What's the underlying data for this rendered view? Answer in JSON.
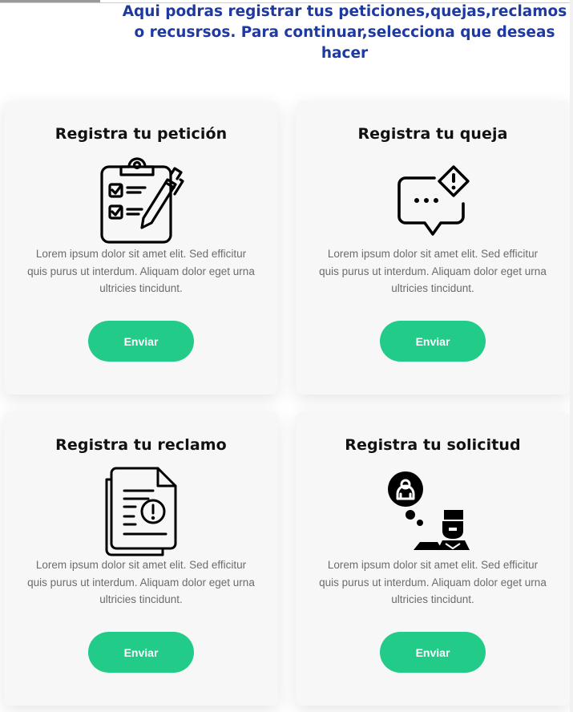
{
  "intro": {
    "text": "Aqui podras registrar tus peticiones,quejas,reclamos o recusrsos. Para continuar,selecciona que deseas hacer"
  },
  "cards": [
    {
      "title": "Registra tu petición",
      "icon": "clipboard-checklist-pen-icon",
      "description": "Lorem ipsum dolor sit amet elit. Sed efficitur quis purus ut interdum. Aliquam dolor eget urna ultricies tincidunt.",
      "button_label": "Enviar"
    },
    {
      "title": "Registra tu queja",
      "icon": "chat-bubble-warning-icon",
      "description": "Lorem ipsum dolor sit amet elit. Sed efficitur quis purus ut interdum. Aliquam dolor eget urna ultricies tincidunt.",
      "button_label": "Enviar"
    },
    {
      "title": "Registra tu reclamo",
      "icon": "document-alert-icon",
      "description": "Lorem ipsum dolor sit amet elit. Sed efficitur quis purus ut interdum. Aliquam dolor eget urna ultricies tincidunt.",
      "button_label": "Enviar"
    },
    {
      "title": "Registra tu solicitud",
      "icon": "person-thinking-request-icon",
      "description": "Lorem ipsum dolor sit amet elit. Sed efficitur quis purus ut interdum. Aliquam dolor eget urna ultricies tincidunt.",
      "button_label": "Enviar"
    }
  ],
  "colors": {
    "intro_text": "#1e3aa0",
    "button": "#22cc88",
    "card_background": "#f7f7f7",
    "title_text": "#111111",
    "description_text": "#6c6c6c"
  }
}
